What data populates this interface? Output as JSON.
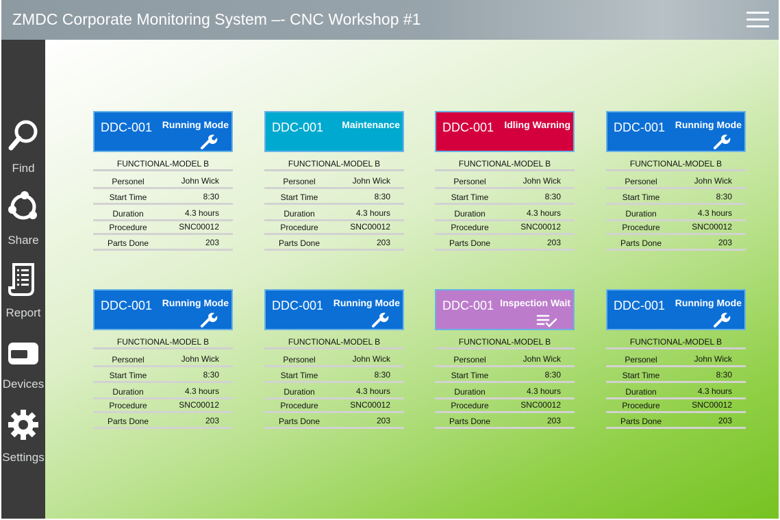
{
  "header": {
    "title": "ZMDC Corporate Monitoring System –- CNC Workshop #1",
    "menu_icon": "hamburger-menu-icon"
  },
  "sidebar": {
    "items": [
      {
        "label": "Find",
        "icon": "magnifier-icon"
      },
      {
        "label": "Share",
        "icon": "share-icon"
      },
      {
        "label": "Report",
        "icon": "report-icon"
      },
      {
        "label": "Devices",
        "icon": "devices-icon"
      },
      {
        "label": "Settings",
        "icon": "gear-icon"
      }
    ]
  },
  "colors": {
    "running": "#0c6fd6",
    "maintenance": "#00a9cf",
    "idling": "#d4003d",
    "inspection": "#bc7ccb",
    "card_border": "#69b3e6",
    "sidebar": "#3a3b3a"
  },
  "row_labels": {
    "personnel": "Personel",
    "start_time": "Start Time",
    "duration": "Duration",
    "procedure": "Procedure",
    "parts_done": "Parts Done"
  },
  "cards": [
    {
      "id": "DDC-001",
      "mode": "Running Mode",
      "status": "running",
      "icon": "wrench-icon",
      "model": "FUNCTIONAL-MODEL B",
      "personnel": "John Wick",
      "start_time": "8:30",
      "duration": "4.3 hours",
      "procedure": "SNC00012",
      "parts_done": "203"
    },
    {
      "id": "DDC-001",
      "mode": "Maintenance",
      "status": "maintenance",
      "icon": "",
      "model": "FUNCTIONAL-MODEL B",
      "personnel": "John Wick",
      "start_time": "8:30",
      "duration": "4.3 hours",
      "procedure": "SNC00012",
      "parts_done": "203"
    },
    {
      "id": "DDC-001",
      "mode": "Idling Warning",
      "status": "idling",
      "icon": "",
      "model": "FUNCTIONAL-MODEL B",
      "personnel": "John Wick",
      "start_time": "8:30",
      "duration": "4.3 hours",
      "procedure": "SNC00012",
      "parts_done": "203"
    },
    {
      "id": "DDC-001",
      "mode": "Running Mode",
      "status": "running",
      "icon": "wrench-icon",
      "model": "FUNCTIONAL-MODEL B",
      "personnel": "John Wick",
      "start_time": "8:30",
      "duration": "4.3 hours",
      "procedure": "SNC00012",
      "parts_done": "203"
    },
    {
      "id": "DDC-001",
      "mode": "Running Mode",
      "status": "running",
      "icon": "wrench-icon",
      "model": "FUNCTIONAL-MODEL B",
      "personnel": "John Wick",
      "start_time": "8:30",
      "duration": "4.3 hours",
      "procedure": "SNC00012",
      "parts_done": "203"
    },
    {
      "id": "DDC-001",
      "mode": "Running Mode",
      "status": "running",
      "icon": "wrench-icon",
      "model": "FUNCTIONAL-MODEL B",
      "personnel": "John Wick",
      "start_time": "8:30",
      "duration": "4.3 hours",
      "procedure": "SNC00012",
      "parts_done": "203"
    },
    {
      "id": "DDC-001",
      "mode": "Inspection Wait",
      "status": "inspection",
      "icon": "checklist-icon",
      "model": "FUNCTIONAL-MODEL B",
      "personnel": "John Wick",
      "start_time": "8:30",
      "duration": "4.3 hours",
      "procedure": "SNC00012",
      "parts_done": "203"
    },
    {
      "id": "DDC-001",
      "mode": "Running Mode",
      "status": "running",
      "icon": "wrench-icon",
      "model": "FUNCTIONAL-MODEL B",
      "personnel": "John Wick",
      "start_time": "8:30",
      "duration": "4.3 hours",
      "procedure": "SNC00012",
      "parts_done": "203"
    }
  ]
}
